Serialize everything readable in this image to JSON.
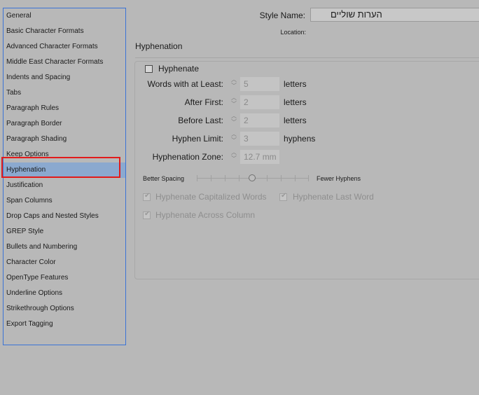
{
  "sidebar": {
    "items": [
      {
        "label": "General"
      },
      {
        "label": "Basic Character Formats"
      },
      {
        "label": "Advanced Character Formats"
      },
      {
        "label": "Middle East Character Formats"
      },
      {
        "label": "Indents and Spacing"
      },
      {
        "label": "Tabs"
      },
      {
        "label": "Paragraph Rules"
      },
      {
        "label": "Paragraph Border"
      },
      {
        "label": "Paragraph Shading"
      },
      {
        "label": "Keep Options"
      },
      {
        "label": "Hyphenation"
      },
      {
        "label": "Justification"
      },
      {
        "label": "Span Columns"
      },
      {
        "label": "Drop Caps and Nested Styles"
      },
      {
        "label": "GREP Style"
      },
      {
        "label": "Bullets and Numbering"
      },
      {
        "label": "Character Color"
      },
      {
        "label": "OpenType Features"
      },
      {
        "label": "Underline Options"
      },
      {
        "label": "Strikethrough Options"
      },
      {
        "label": "Export Tagging"
      }
    ],
    "selected": "Hyphenation"
  },
  "header": {
    "style_name_label": "Style Name:",
    "style_name_value": "הערות שוליים",
    "location_label": "Location:"
  },
  "section": {
    "title": "Hyphenation",
    "hyphenate_label": "Hyphenate",
    "hyphenate_checked": false,
    "rows": [
      {
        "label": "Words with at Least:",
        "value": "5",
        "unit": "letters"
      },
      {
        "label": "After First:",
        "value": "2",
        "unit": "letters"
      },
      {
        "label": "Before Last:",
        "value": "2",
        "unit": "letters"
      },
      {
        "label": "Hyphen Limit:",
        "value": "3",
        "unit": "hyphens"
      },
      {
        "label": "Hyphenation Zone:",
        "value": "12.7 mm",
        "unit": ""
      }
    ],
    "slider": {
      "left_label": "Better Spacing",
      "right_label": "Fewer Hyphens",
      "position_fraction": 0.5
    },
    "options": [
      {
        "label": "Hyphenate Capitalized Words",
        "checked": true,
        "enabled": false
      },
      {
        "label": "Hyphenate Last Word",
        "checked": true,
        "enabled": false
      },
      {
        "label": "Hyphenate Across Column",
        "checked": true,
        "enabled": false
      }
    ]
  },
  "colors": {
    "selection_bg": "#8ba9cf",
    "highlight_outline": "#e21b1b",
    "sidebar_border": "#3a73d6"
  }
}
